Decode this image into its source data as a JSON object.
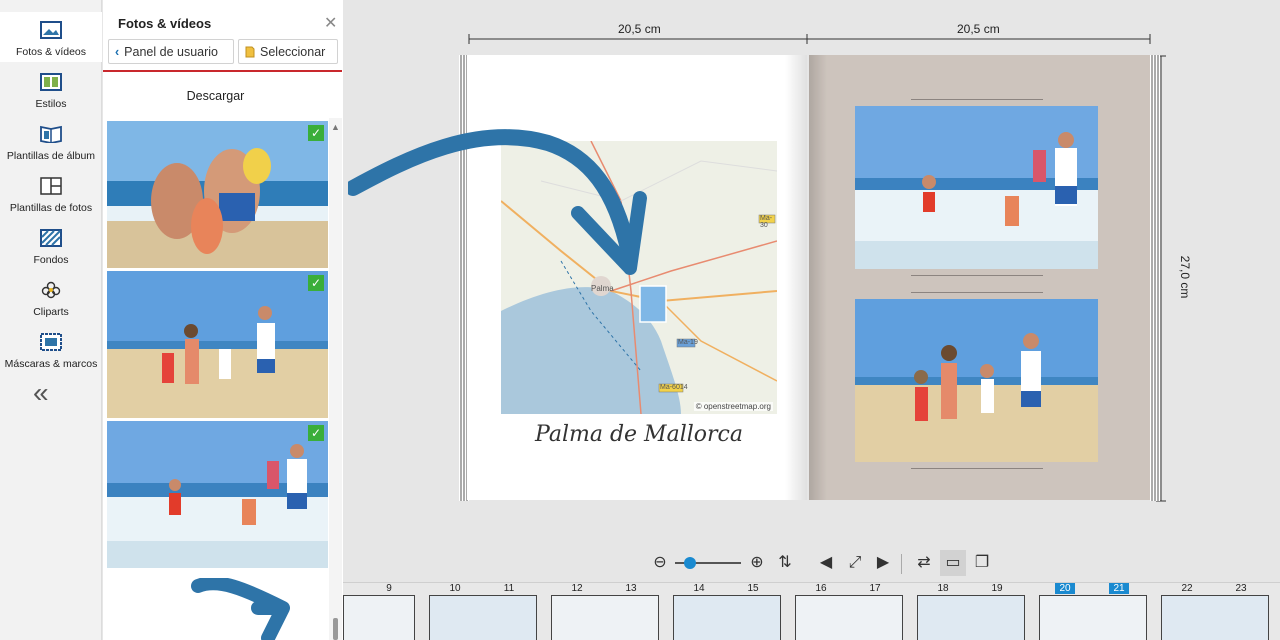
{
  "nav": {
    "items": [
      {
        "label": "Fotos & vídeos",
        "icon": "photo-icon"
      },
      {
        "label": "Estilos",
        "icon": "styles-icon"
      },
      {
        "label": "Plantillas de álbum",
        "icon": "album-template-icon"
      },
      {
        "label": "Plantillas de fotos",
        "icon": "photo-template-icon"
      },
      {
        "label": "Fondos",
        "icon": "background-icon"
      },
      {
        "label": "Cliparts",
        "icon": "clipart-icon"
      },
      {
        "label": "Máscaras & marcos",
        "icon": "masks-frames-icon"
      }
    ],
    "collapse_label": "«"
  },
  "panel": {
    "title": "Fotos & vídeos",
    "back_label": "Panel de usuario",
    "select_label": "Seleccionar",
    "download_label": "Descargar"
  },
  "editor": {
    "width_left": "20,5 cm",
    "width_right": "20,5 cm",
    "height": "27,0 cm",
    "caption": "Palma de Mallorca",
    "map_attribution": "© openstreetmap.org",
    "map_city": "Palma",
    "map_roads": [
      "Ma-30",
      "Ma-19",
      "Ma-6014"
    ]
  },
  "filmstrip": {
    "pages": [
      "9",
      "10",
      "11",
      "12",
      "13",
      "14",
      "15",
      "16",
      "17",
      "18",
      "19",
      "20",
      "21",
      "22",
      "23"
    ],
    "highlighted": [
      "20",
      "21"
    ]
  },
  "colors": {
    "accent_red": "#c9282d",
    "highlight_blue": "#1a8ad0",
    "arrow_blue": "#2e74a8",
    "check_green": "#3aae3a"
  }
}
